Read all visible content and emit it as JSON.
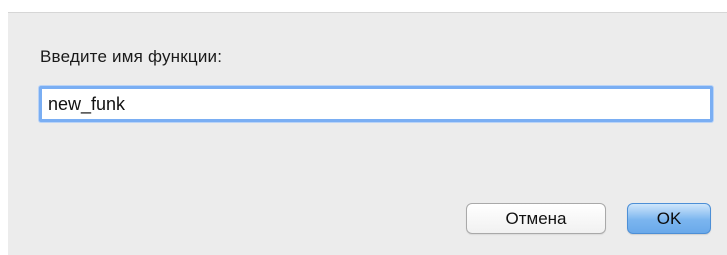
{
  "dialog": {
    "prompt": "Введите имя функции:",
    "input_value": "new_funk",
    "cancel_label": "Отмена",
    "ok_label": "OK"
  },
  "colors": {
    "dialog_background": "#ececec",
    "focus_ring": "#7aaef3",
    "default_button": "#7bb5ef"
  }
}
